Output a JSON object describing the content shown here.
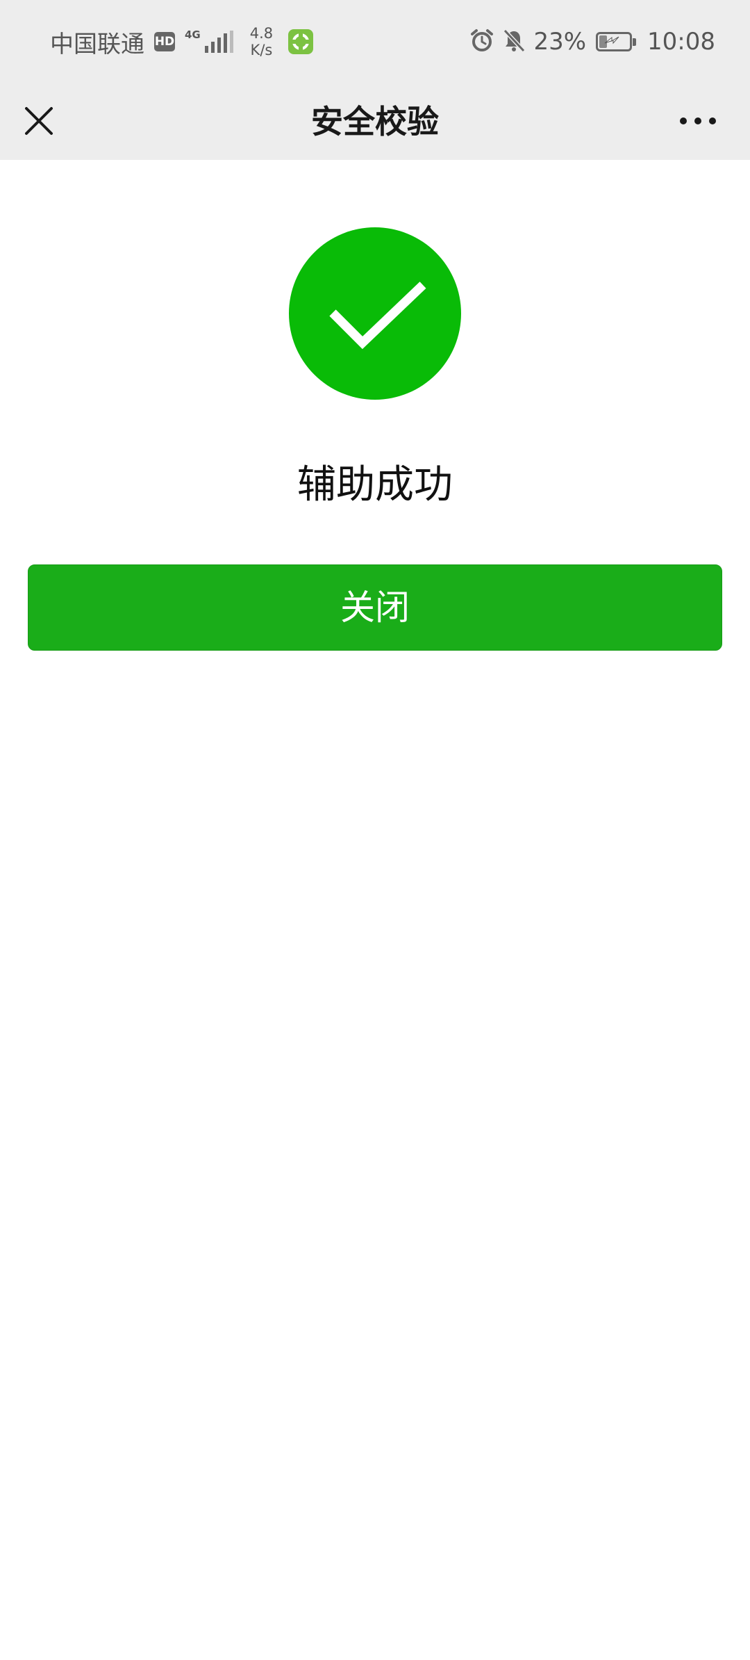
{
  "status_bar": {
    "carrier": "中国联通",
    "hd_badge": "HD",
    "network_type": "4G",
    "network_speed_value": "4.8",
    "network_speed_unit": "K/s",
    "battery_percent": "23%",
    "battery_level": 0.23,
    "time": "10:08",
    "icons": [
      "hd-icon",
      "signal-icon",
      "app-notification-icon",
      "alarm-icon",
      "bell-muted-icon",
      "battery-charging-icon"
    ]
  },
  "nav": {
    "title": "安全校验",
    "left_icon": "close-icon",
    "right_icon": "more-icon"
  },
  "result": {
    "icon": "success-check-icon",
    "icon_color": "#09bb07",
    "message": "辅助成功"
  },
  "actions": {
    "close_label": "关闭",
    "button_color": "#1aad19"
  }
}
